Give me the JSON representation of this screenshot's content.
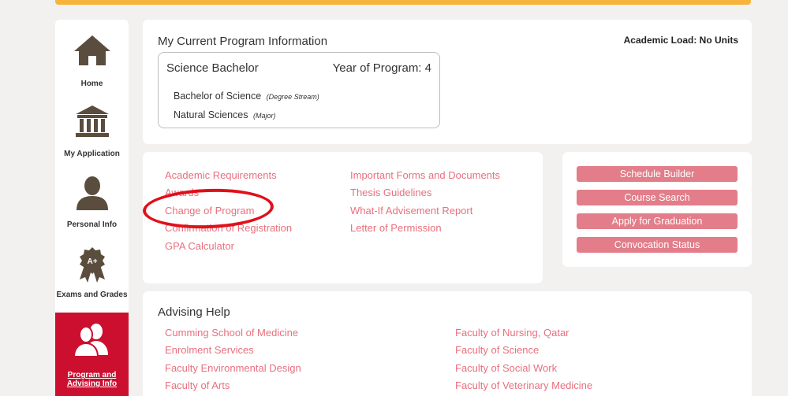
{
  "sidebar": {
    "items": [
      {
        "label": "Home",
        "icon": "house-icon"
      },
      {
        "label": "My Application",
        "icon": "institution-icon"
      },
      {
        "label": "Personal Info",
        "icon": "person-icon"
      },
      {
        "label": "Exams and Grades",
        "icon": "grade-ribbon-icon"
      },
      {
        "label": "Program and Advising Info",
        "icon": "people-icon"
      }
    ]
  },
  "program": {
    "title": "My Current Program Information",
    "academic_load": "Academic Load: No Units",
    "name": "Science Bachelor",
    "year": "Year of Program: 4",
    "degree": "Bachelor of Science",
    "degree_note": "(Degree Stream)",
    "major": "Natural Sciences",
    "major_note": "(Major)"
  },
  "links": {
    "left": [
      "Academic Requirements",
      "Awards",
      "Change of Program",
      "Confirmation of Registration",
      "GPA Calculator"
    ],
    "right": [
      "Important Forms and Documents",
      "Thesis Guidelines",
      "What-If Advisement Report",
      "Letter of Permission"
    ]
  },
  "buttons": [
    "Schedule Builder",
    "Course Search",
    "Apply for Graduation",
    "Convocation Status"
  ],
  "advising": {
    "title": "Advising Help",
    "left": [
      "Cumming School of Medicine",
      "Enrolment Services",
      "Faculty Environmental Design",
      "Faculty of Arts"
    ],
    "right": [
      "Faculty of Nursing, Qatar",
      "Faculty of Science",
      "Faculty of Social Work",
      "Faculty of Veterinary Medicine"
    ]
  },
  "colors": {
    "accent": "#cc0f2f",
    "link": "#e8707e",
    "button": "#e27d89",
    "highlight": "#f6b43c",
    "annotation": "#e0101a"
  }
}
